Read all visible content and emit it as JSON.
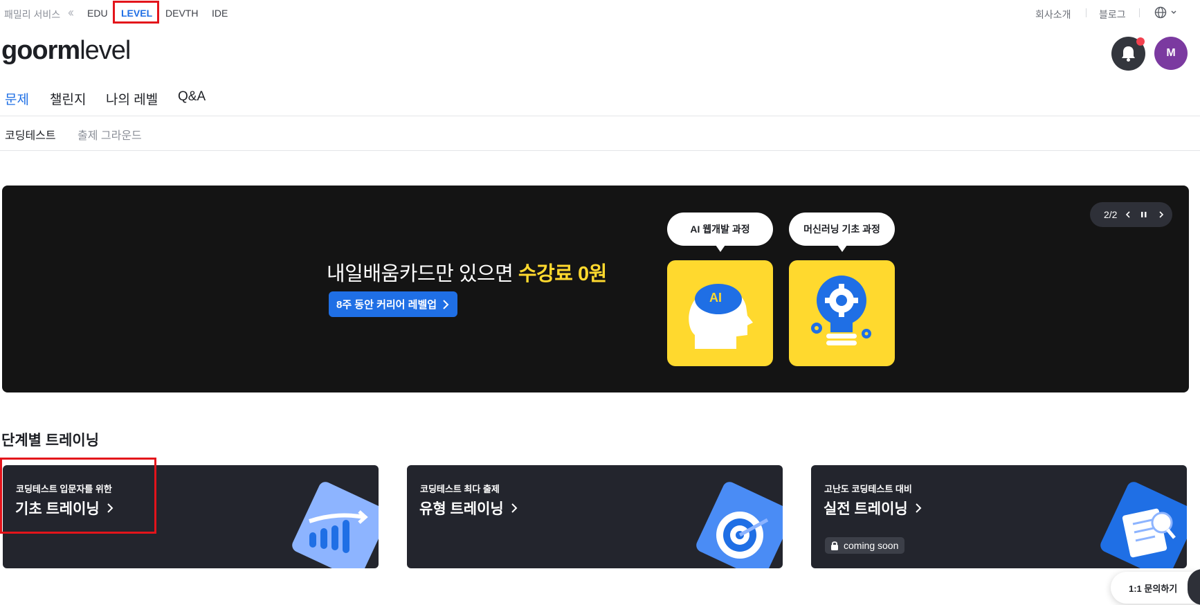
{
  "family_bar": {
    "label": "패밀리 서비스",
    "collapse_icon": "double-chevron-left-icon",
    "services": [
      "EDU",
      "LEVEL",
      "DEVTH",
      "IDE"
    ],
    "active_service": "LEVEL",
    "company_link": "회사소개",
    "blog_link": "블로그",
    "language_icon": "globe-icon"
  },
  "header": {
    "logo_bold": "goorm",
    "logo_light": "level",
    "notification_icon": "bell-icon",
    "avatar_initial": "M"
  },
  "main_nav": [
    "문제",
    "챌린지",
    "나의 레벨",
    "Q&A"
  ],
  "sub_nav": [
    "코딩테스트",
    "출제 그라운드"
  ],
  "banner": {
    "headline_prefix": "내일배움카드만 있으면 ",
    "headline_highlight": "수강료 0원",
    "cta_label": "8주 동안 커리어 레벨업",
    "course_1": "AI 웹개발 과정",
    "course_2": "머신러닝 기초 과정",
    "course_1_icon_text": "AI",
    "pager_text": "2/2"
  },
  "training": {
    "section_title": "단계별 트레이닝",
    "cards": [
      {
        "subtitle": "코딩테스트 입문자를 위한",
        "title": "기초 트레이닝"
      },
      {
        "subtitle": "코딩테스트 최다 출제",
        "title": "유형 트레이닝"
      },
      {
        "subtitle": "고난도 코딩테스트 대비",
        "title": "실전 트레이닝",
        "badge": "coming soon"
      }
    ]
  },
  "inquiry": {
    "label": "1:1 문의하기"
  },
  "colors": {
    "accent": "#1f6fe5",
    "banner_bg": "#141414",
    "highlight_yellow": "#ffd92e",
    "card_bg": "#23252d",
    "annotation_red": "#e3141b",
    "avatar_bg": "#7b3aa0"
  }
}
